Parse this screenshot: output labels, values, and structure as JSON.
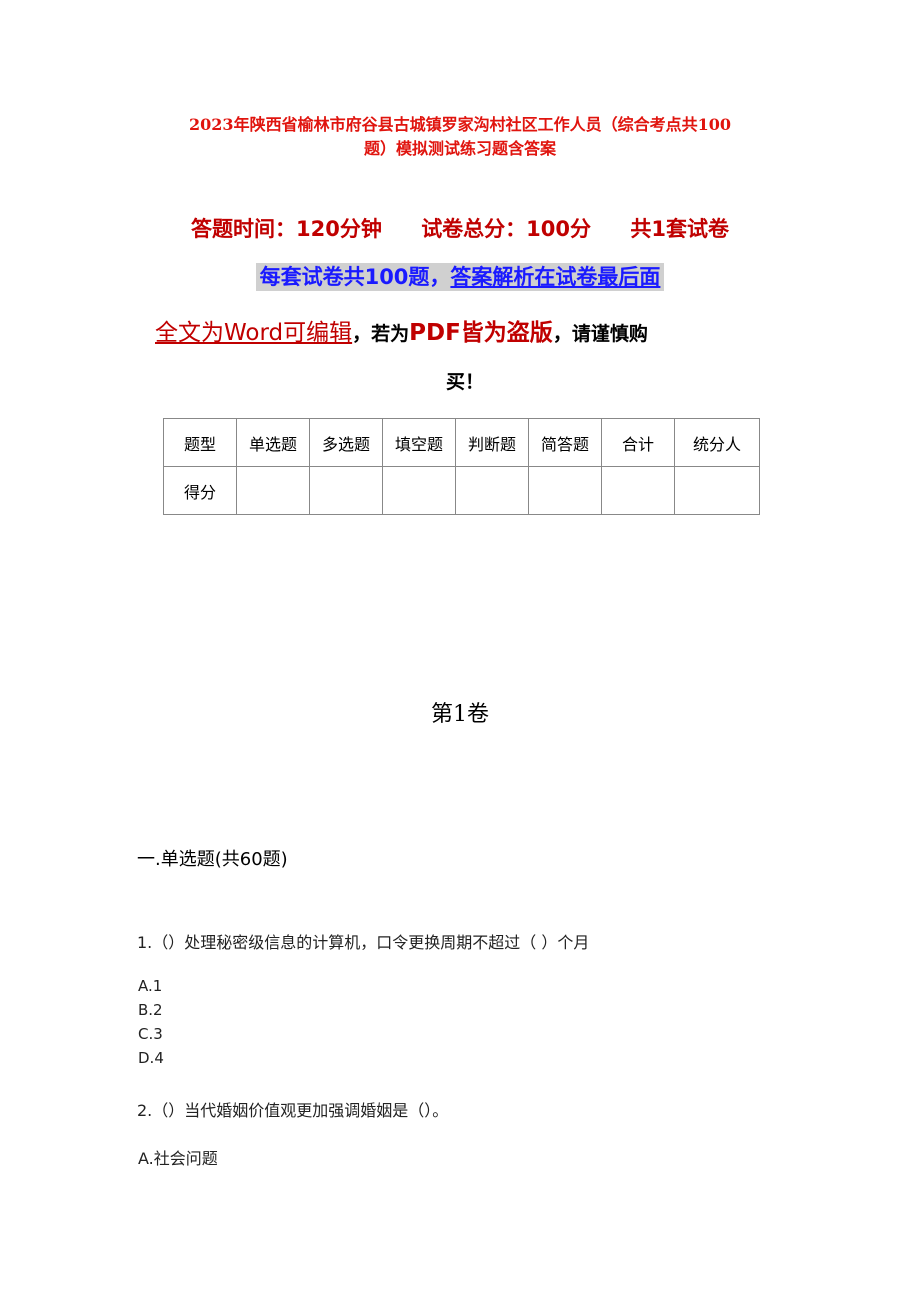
{
  "title": {
    "line1": "2023年陕西省榆林市府谷县古城镇罗家沟村社区工作人员（综合考点共100",
    "line2": "题）模拟测试练习题含答案"
  },
  "meta": {
    "time": "答题时间：120分钟",
    "score": "试卷总分：100分",
    "sets": "共1套试卷"
  },
  "banner": {
    "part1": "每套试卷共100题，",
    "part2": "答案解析在试卷最后面"
  },
  "notice": {
    "editable": "全文为Word可编辑",
    "comma1": "，若为",
    "pdf": "PDF皆为盗版",
    "tail": "，请谨慎购",
    "line2": "买！"
  },
  "score_table": {
    "header": [
      "题型",
      "单选题",
      "多选题",
      "填空题",
      "判断题",
      "简答题",
      "合计",
      "统分人"
    ],
    "row": [
      "得分",
      "",
      "",
      "",
      "",
      "",
      "",
      ""
    ]
  },
  "volume": "第1卷",
  "section": "一.单选题(共60题)",
  "questions": [
    {
      "text": "1.（）处理秘密级信息的计算机，口令更换周期不超过（  ）个月",
      "options": [
        "A.1",
        "B.2",
        "C.3",
        "D.4"
      ]
    },
    {
      "text": "2.（）当代婚姻价值观更加强调婚姻是（）。",
      "options": [
        "A.社会问题"
      ]
    }
  ]
}
